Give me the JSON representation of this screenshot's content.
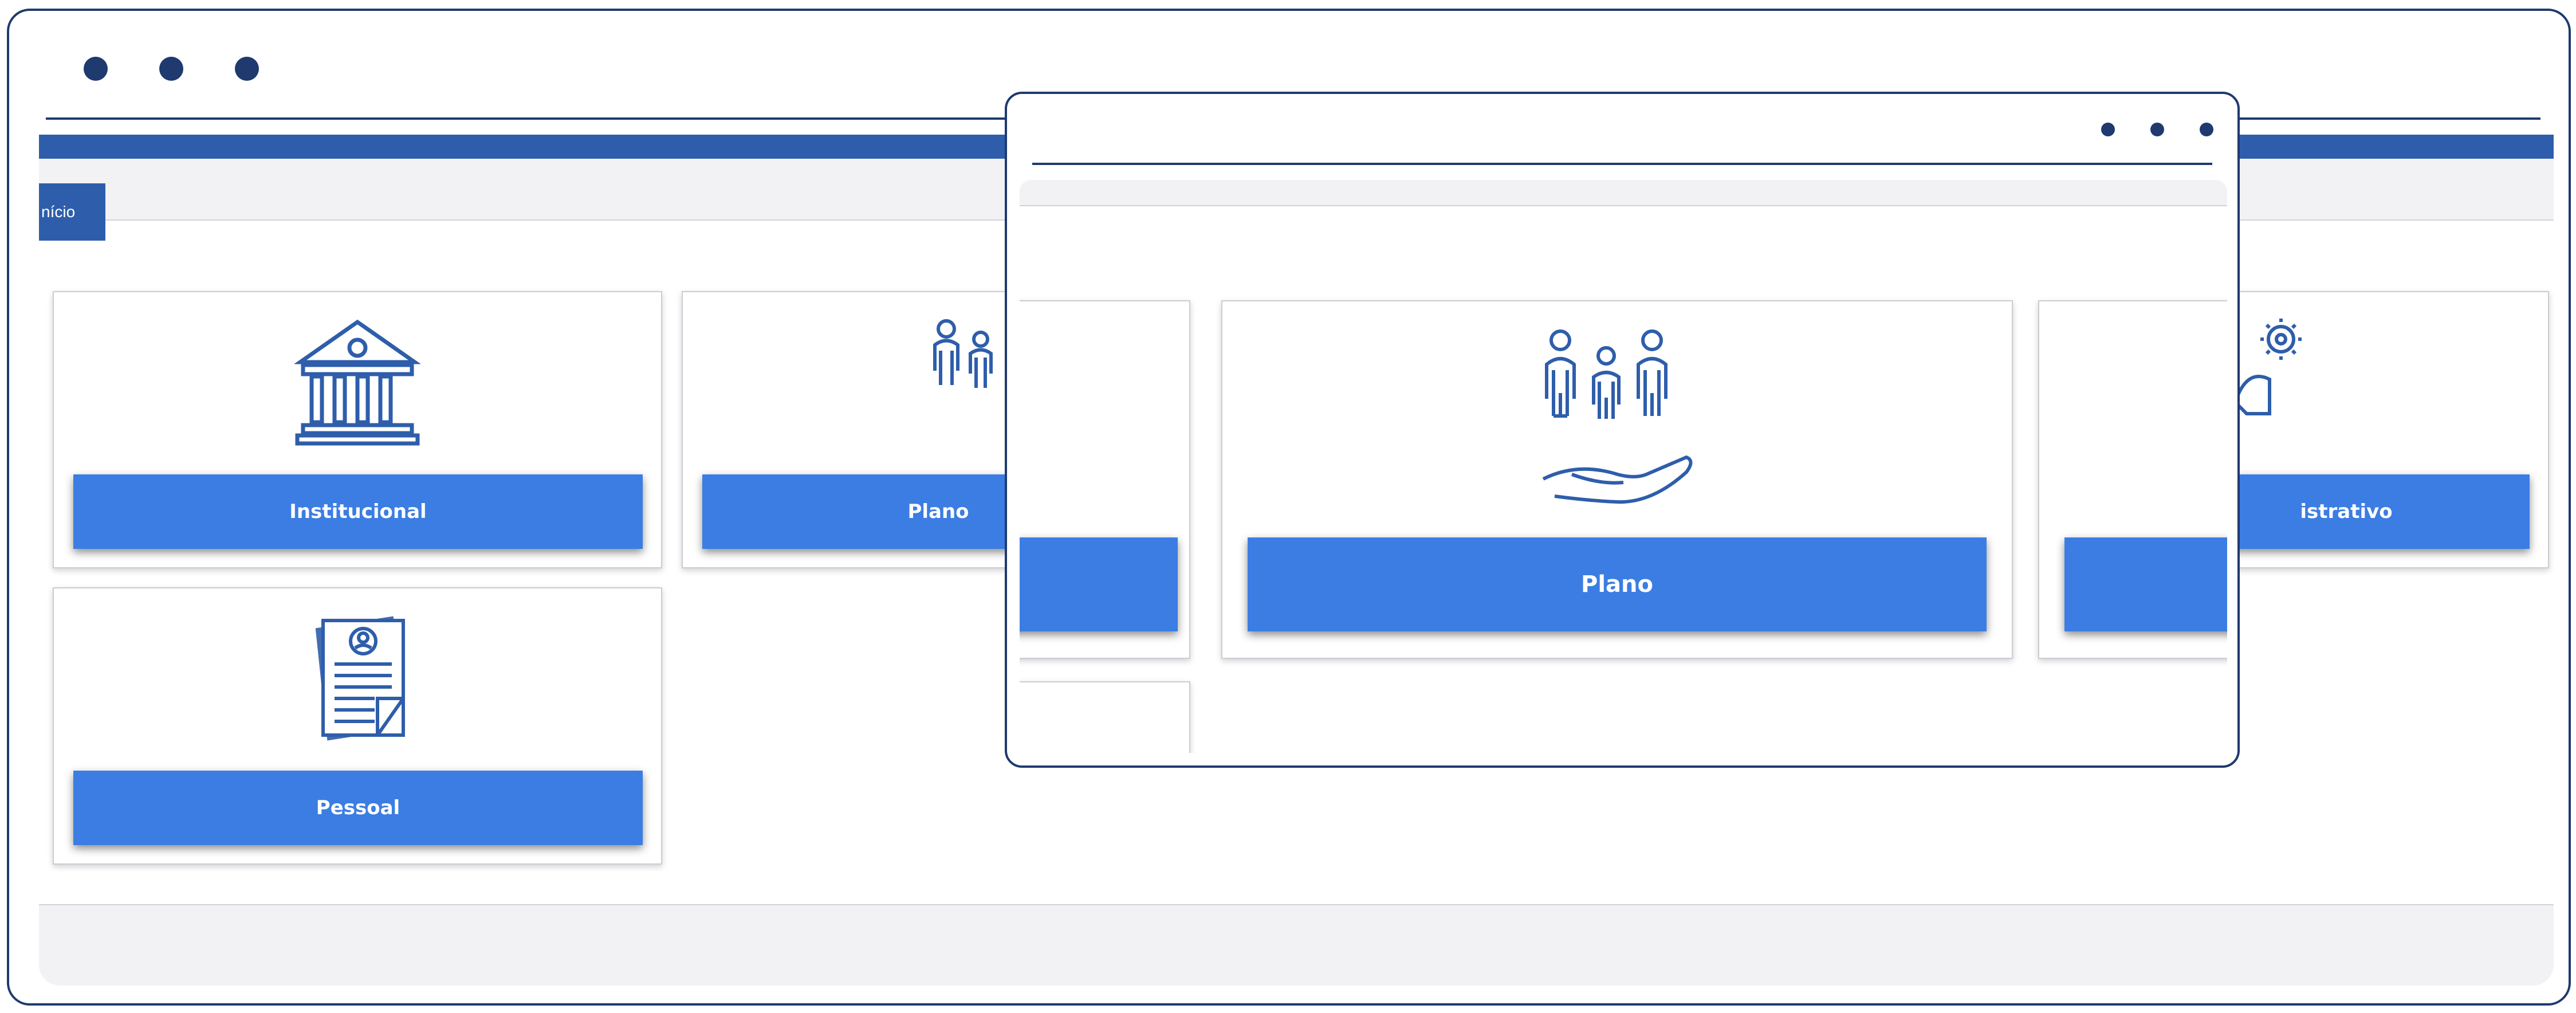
{
  "window": {
    "tab_label": "nício"
  },
  "cards": {
    "institucional": "Institucional",
    "plano": "Plano",
    "administrativo_partial": "istrativo",
    "pessoal": "Pessoal"
  },
  "zoom": {
    "plano_label": "Plano"
  },
  "colors": {
    "frame": "#1e3a6e",
    "brand_bar": "#2e5eab",
    "button": "#3b7de3",
    "panel": "#f2f2f5"
  },
  "icons": [
    "bank-building-icon",
    "family-hand-icon",
    "admin-gear-person-icon",
    "personal-document-icon"
  ]
}
